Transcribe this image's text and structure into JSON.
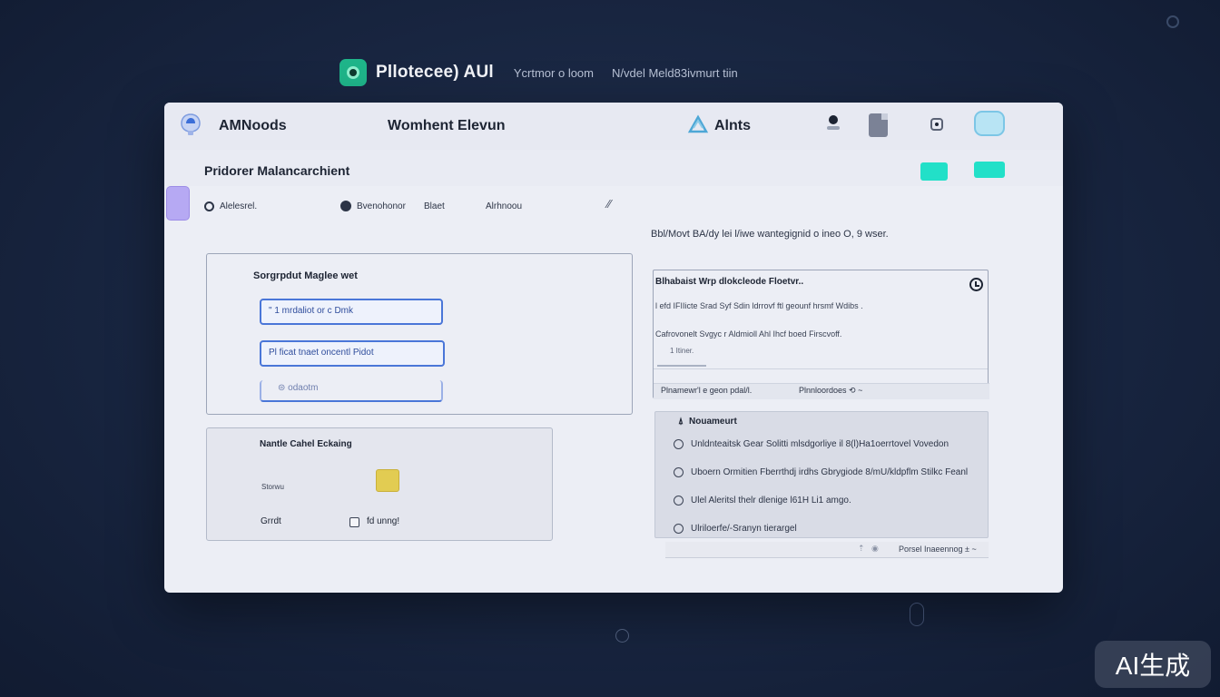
{
  "app": {
    "title": "Pllotecee) AUl",
    "top_links": [
      "Ycrtmor o loom",
      "N/vdel Meld83ivmurt tiin"
    ]
  },
  "window": {
    "toolbar": {
      "nodes_label": "AMNoods",
      "center_title": "Womhent Elevun",
      "alerts_label": "Alnts"
    },
    "page_title": "Pridorer Malancarchient",
    "filters": [
      "Alelesrel.",
      "Bvenohonor",
      "Blaet",
      "Alrhnoou"
    ],
    "right_caption": "Bbl/Movt BA/dy lei l/iwe wantegignid o ineo O, 9 wser.",
    "left_card": {
      "title": "Sorgrpdut Maglee wet",
      "input_1": "\" 1 mrdaliot or c Dmk",
      "input_2": "Pl ficat tnaet oncentl Pidot",
      "input_3": "⊜ odaotm"
    },
    "left_card2": {
      "title": "Nantle Cahel Eckaing",
      "small_label": "Storwu",
      "check_left": "Grrdt",
      "check_label": "fd unng!"
    },
    "right_card": {
      "title": "Blhabaist Wrp dlokcleode Floetvr..",
      "line_1": "l efd IFIIicte Srad Syf Sdin ldrrovf ftl geounf hrsmf Wdibs .",
      "line_2": "Cafrovonelt Svgyc r Aldmioll Ahl Ihcf boed Firscvoff.",
      "small_btn": "1 Itiner.",
      "footer_1": "Plnamewr'l e geon pdal/l.",
      "footer_2": "Plnnloordoes ⟲ ~"
    },
    "right_card2": {
      "title": "Nouameurt",
      "rows": [
        "Unldnteaitsk Gear Solitti mlsdgorliye il 8(l)Ha1oerrtovel Vovedon",
        "Uboern Ormitien Fberrthdj irdhs Gbrygiode 8/mU/kldpflm Stilkc Feanl",
        "Ulel Aleritsl thelr dlenige l61H Li1 amgo.",
        "Ulriloerfe/-Sranyn tierargel"
      ]
    },
    "right_footer": "Porsel Inaeennog ± ~"
  },
  "watermark": "AI生成"
}
